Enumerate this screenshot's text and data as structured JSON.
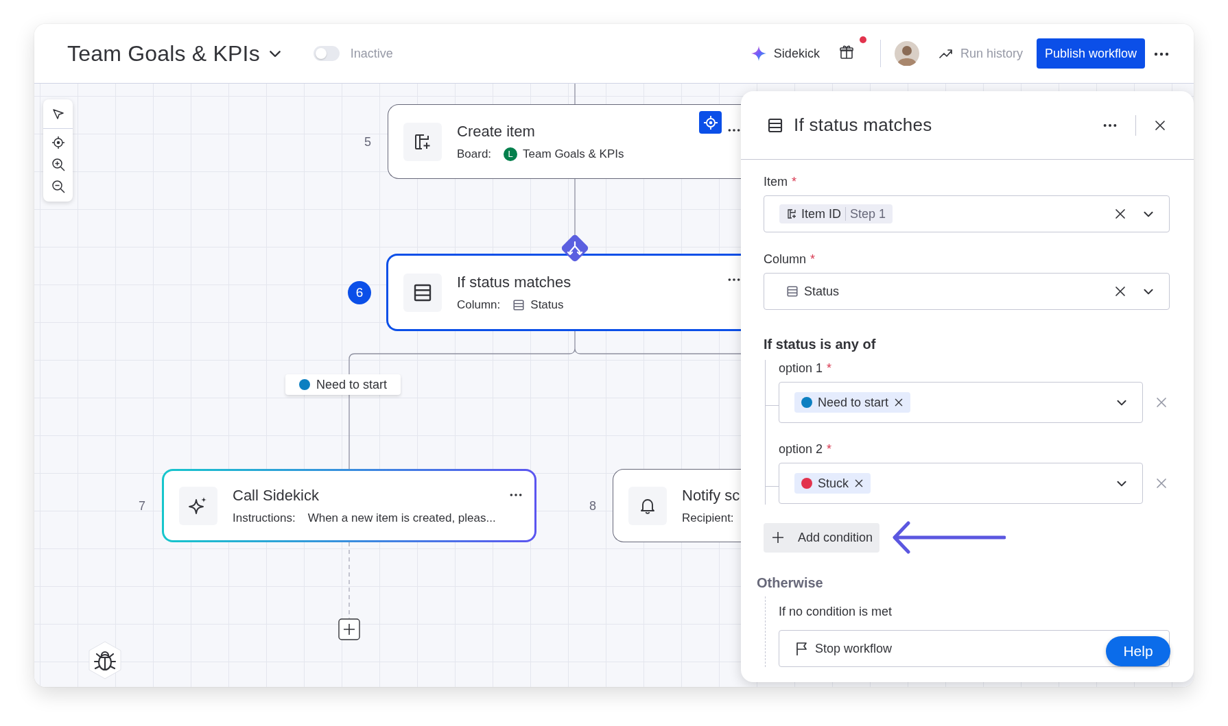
{
  "header": {
    "title": "Team Goals & KPIs",
    "status_toggle": {
      "on": false,
      "label": "Inactive"
    },
    "sidekick": "Sidekick",
    "gift_unread": true,
    "run_history": "Run history",
    "publish_button": "Publish workflow"
  },
  "canvas": {
    "nodes": [
      {
        "kind": "create",
        "step": "5",
        "title": "Create item",
        "field": "Board:",
        "value": "Team Goals & KPIs",
        "value_badge": "L",
        "selected": false,
        "locate_button": true
      },
      {
        "kind": "condition",
        "step": "6",
        "title": "If status matches",
        "field": "Column:",
        "value": "Status",
        "selected": true,
        "locate_button": false
      },
      {
        "kind": "ai",
        "step": "7",
        "title": "Call Sidekick",
        "field": "Instructions:",
        "value": "When a new item is created, pleas...",
        "selected": false,
        "locate_button": false
      },
      {
        "kind": "notify",
        "step": "8",
        "title": "Notify sc",
        "field": "Recipient:",
        "selected": false,
        "locate_button": false
      }
    ],
    "branch_label": {
      "text": "Need to start",
      "color": "#0c7fc1"
    }
  },
  "panel": {
    "title": "If status matches",
    "fields": [
      {
        "kind": "item",
        "label": "Item",
        "required_mark": "*",
        "chip": "Item ID",
        "chip_source": "Step 1"
      },
      {
        "kind": "column",
        "label": "Column",
        "required_mark": "*",
        "chip": "Status"
      }
    ],
    "section_title": "If status is any of",
    "options": [
      {
        "label": "option 1",
        "required_mark": "*",
        "value": "Need to start",
        "color": "#0c7fc1"
      },
      {
        "label": "option 2",
        "required_mark": "*",
        "value": "Stuck",
        "color": "#e2334d"
      }
    ],
    "add_button": "Add condition",
    "otherwise": {
      "heading": "Otherwise",
      "label": "If no condition is met",
      "action": "Stop workflow"
    },
    "help_button": "Help"
  }
}
